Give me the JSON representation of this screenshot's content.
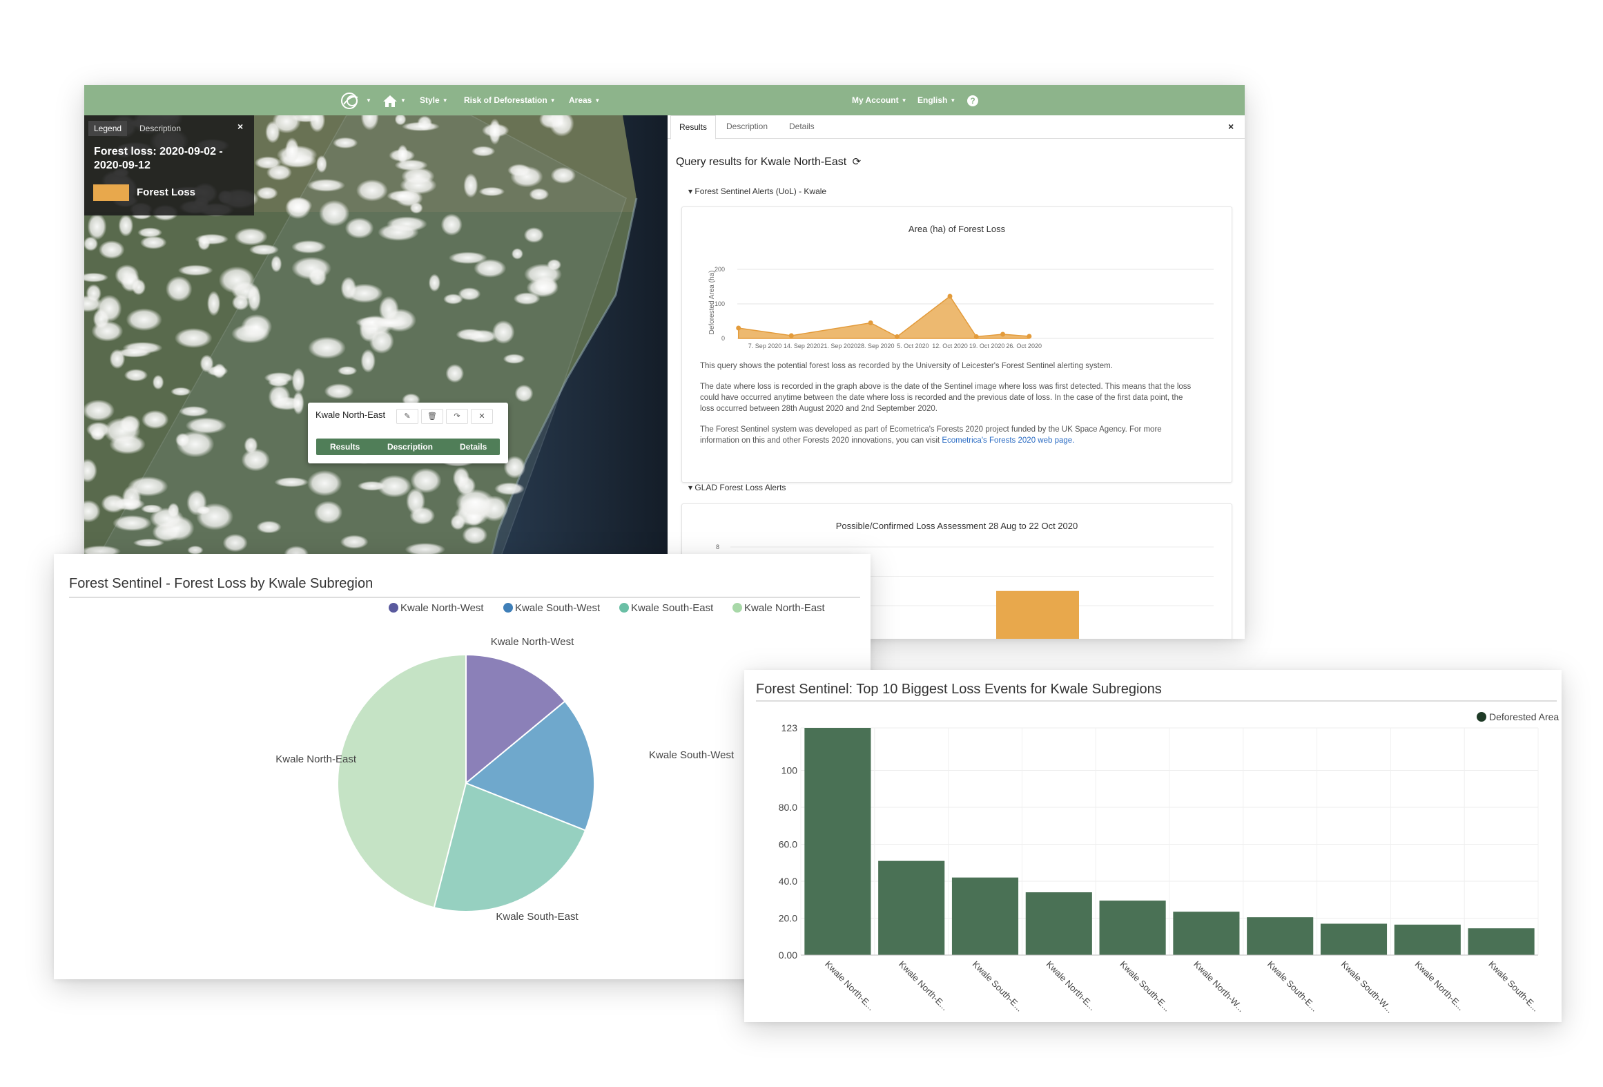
{
  "navbar": {
    "items": [
      {
        "label": "Style"
      },
      {
        "label": "Risk of Deforestation"
      },
      {
        "label": "Areas"
      },
      {
        "label": "My Account"
      },
      {
        "label": "English"
      }
    ]
  },
  "legend_panel": {
    "tabs": [
      "Legend",
      "Description"
    ],
    "close": "×",
    "title": "Forest loss: 2020-09-02 - 2020-09-12",
    "items": [
      {
        "label": "Forest Loss",
        "color": "#e8a84c"
      }
    ]
  },
  "map_popup": {
    "title": "Kwale North-East",
    "tabs": [
      "Results",
      "Description",
      "Details"
    ]
  },
  "results_panel": {
    "tabs": [
      "Results",
      "Description",
      "Details"
    ],
    "close": "×",
    "query_title": "Query results for Kwale North-East",
    "sections": [
      {
        "title": "Forest Sentinel Alerts (UoL) - Kwale",
        "chart": {
          "title": "Area (ha) of Forest Loss",
          "ylabel": "Deforested Area (ha)",
          "y_ticks": [
            "200",
            "100",
            "0"
          ],
          "x_ticks": [
            "7. Sep 2020",
            "14. Sep 2020",
            "21. Sep 2020",
            "28. Sep 2020",
            "5. Oct 2020",
            "12. Oct 2020",
            "19. Oct 2020",
            "26. Oct 2020"
          ]
        },
        "paragraphs": [
          "This query shows the potential forest loss as recorded by the University of Leicester's Forest Sentinel alerting system.",
          "The date where loss is recorded in the graph above is the date of the Sentinel image where loss was first detected. This means that the loss could have occurred anytime between the date where loss is recorded and the previous date of loss. In the case of the first data point, the loss occurred between 28th August 2020 and 2nd September 2020.",
          "The Forest Sentinel system was developed as part of Ecometrica's Forests 2020 project funded by the UK Space Agency. For more information on this and other Forests 2020 innovations, you can visit "
        ],
        "link_text": "Ecometrica's Forests 2020 web page."
      },
      {
        "title": "GLAD Forest Loss Alerts",
        "chart": {
          "title": "Possible/Confirmed Loss Assessment 28 Aug to 22 Oct 2020",
          "y_ticks": [
            "8"
          ]
        }
      }
    ]
  },
  "pie_window": {
    "title": "Forest Sentinel - Forest Loss by Kwale Subregion"
  },
  "bar_window": {
    "title": "Forest Sentinel: Top 10 Biggest Loss Events for Kwale Subregions"
  },
  "chart_data": [
    {
      "type": "area",
      "title": "Area (ha) of Forest Loss",
      "ylabel": "Deforested Area (ha)",
      "ylim": [
        0,
        200
      ],
      "x": [
        "2020-09-02",
        "2020-09-12",
        "2020-09-27",
        "2020-10-02",
        "2020-10-12",
        "2020-10-17",
        "2020-10-22",
        "2020-10-27"
      ],
      "series": [
        {
          "values": [
            30,
            8,
            45,
            5,
            122,
            5,
            12,
            6
          ],
          "color": "#e8a84c"
        }
      ]
    },
    {
      "type": "bar",
      "title": "Possible/Confirmed Loss Assessment 28 Aug to 22 Oct 2020",
      "categories": [
        ""
      ],
      "values": [
        5
      ],
      "ylim": [
        0,
        8
      ],
      "color": "#e8a84c"
    },
    {
      "type": "pie",
      "title": "Forest Sentinel - Forest Loss by Kwale Subregion",
      "legend_position": "top-right",
      "categories": [
        "Kwale North-West",
        "Kwale South-West",
        "Kwale South-East",
        "Kwale North-East"
      ],
      "values": [
        14,
        17,
        23,
        46
      ],
      "colors": [
        "#8b80b8",
        "#6fa8cc",
        "#96d0c0",
        "#c5e3c5"
      ],
      "legend_colors": [
        "#5a5a9e",
        "#3f7fb8",
        "#6abfa5",
        "#a8d8a8"
      ]
    },
    {
      "type": "bar",
      "title": "Forest Sentinel: Top 10 Biggest Loss Events for Kwale Subregions",
      "legend": [
        "Deforested Area (ha)"
      ],
      "legend_position": "top-right",
      "categories": [
        "Kwale North-E...",
        "Kwale North-E...",
        "Kwale South-E...",
        "Kwale North-E...",
        "Kwale South-E...",
        "Kwale North-W...",
        "Kwale South-E...",
        "Kwale South-W...",
        "Kwale North-E...",
        "Kwale South-E..."
      ],
      "values": [
        123,
        51,
        42,
        34,
        29.5,
        23.5,
        20.5,
        17,
        16.5,
        14.5
      ],
      "y_ticks": [
        "123",
        "100",
        "80.0",
        "60.0",
        "40.0",
        "20.0",
        "0.00"
      ],
      "ylim": [
        0,
        123
      ],
      "color": "#4a7155"
    }
  ]
}
